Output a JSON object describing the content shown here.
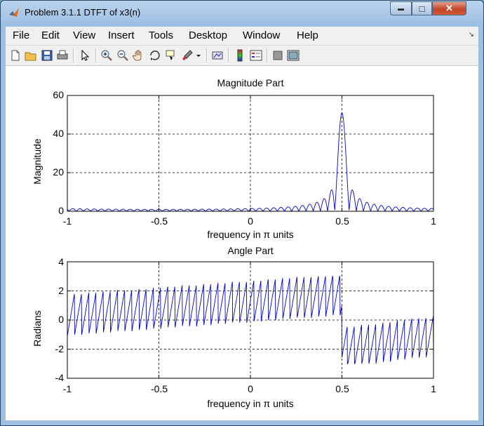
{
  "window": {
    "title": "Problem 3.1.1 DTFT of x3(n)",
    "min_glyph": "▬",
    "max_glyph": "□",
    "close_glyph": "✕"
  },
  "menu": [
    "File",
    "Edit",
    "View",
    "Insert",
    "Tools",
    "Desktop",
    "Window",
    "Help"
  ],
  "menu_overflow_glyph": "↘",
  "toolbar": [
    "new-figure-icon",
    "open-file-icon",
    "save-icon",
    "print-icon",
    "select-arrow-icon",
    "zoom-in-icon",
    "zoom-out-icon",
    "pan-hand-icon",
    "rotate-3d-icon",
    "data-cursor-icon",
    "brush-icon",
    "brush-dropdown-icon",
    "link-plot-icon",
    "colorbar-icon",
    "legend-icon",
    "hide-plot-tools-icon",
    "show-plot-tools-icon"
  ],
  "chart_data": [
    {
      "type": "line",
      "title": "Magnitude Part",
      "xlabel": "frequency in π units",
      "ylabel": "Magnitude",
      "xlim": [
        -1,
        1
      ],
      "ylim": [
        0,
        60
      ],
      "xticks": [
        "-1",
        "-0.5",
        "0",
        "0.5",
        "1"
      ],
      "yticks": [
        "0",
        "20",
        "40",
        "60"
      ],
      "grid": true,
      "color": "#0000cc",
      "description_points": {
        "x": [
          -1,
          -0.5,
          0,
          0.3,
          0.4,
          0.45,
          0.48,
          0.5,
          0.52,
          0.55,
          0.6,
          0.7,
          0.8,
          1
        ],
        "y": [
          1,
          0.9,
          1.1,
          2,
          4,
          11,
          35,
          51,
          35,
          11,
          4,
          2,
          1.5,
          1
        ]
      }
    },
    {
      "type": "line",
      "title": "Angle Part",
      "xlabel": "frequency in π units",
      "ylabel": "Radians",
      "xlim": [
        -1,
        1
      ],
      "ylim": [
        -4,
        4
      ],
      "xticks": [
        "-1",
        "-0.5",
        "0",
        "0.5",
        "1"
      ],
      "yticks": [
        "-4",
        "-2",
        "0",
        "2",
        "4"
      ],
      "grid": true,
      "color": "#0000cc",
      "description_points": {
        "x": [
          -1,
          -0.5,
          0,
          0.45,
          0.5,
          0.55,
          1
        ],
        "y": [
          0.8,
          1.3,
          2.0,
          2.9,
          -0.1,
          -2.9,
          -1.5
        ]
      }
    }
  ]
}
